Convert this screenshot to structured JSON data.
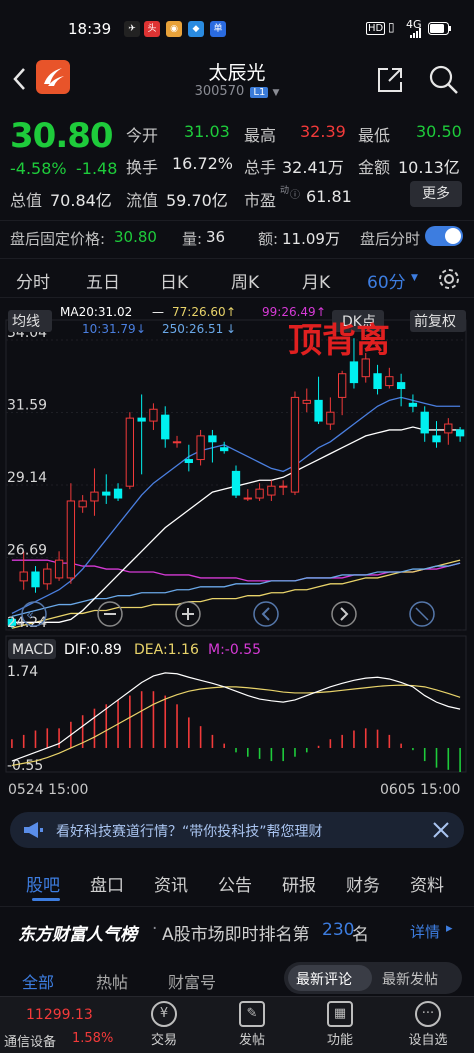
{
  "status_bar": {
    "time": "18:39",
    "signal": "4G",
    "battery": "69"
  },
  "header": {
    "stock_name": "太辰光",
    "stock_code": "300570",
    "market_badge": "L1"
  },
  "quote": {
    "price": "30.80",
    "change_pct": "-4.58%",
    "change": "-1.48",
    "open_label": "今开",
    "open": "31.03",
    "high_label": "最高",
    "high": "32.39",
    "low_label": "最低",
    "low": "30.50",
    "turnover_label": "换手",
    "turnover": "16.72%",
    "volume_label": "总手",
    "volume": "32.41万",
    "amount_label": "金额",
    "amount": "10.13亿",
    "mktcap_label": "总值",
    "mktcap": "70.84亿",
    "float_label": "流值",
    "float_cap": "59.70亿",
    "pe_label": "市盈",
    "pe_sup": "动",
    "pe": "61.81",
    "more_label": "更多"
  },
  "after_hours": {
    "price_label": "盘后固定价格:",
    "price": "30.80",
    "vol_label": "量:",
    "vol": "36",
    "amt_label": "额:",
    "amt": "11.09万",
    "switch_label": "盘后分时"
  },
  "period_tabs": [
    "分时",
    "五日",
    "日K",
    "周K",
    "月K",
    "60分"
  ],
  "active_period": "60分",
  "chart": {
    "ma_button": "均线",
    "ma20": "MA20:31.02",
    "ma77": "77:26.60",
    "ma99": "99:26.49",
    "ma10": "10:31.79",
    "ma250": "250:26.51",
    "dk_label": "DK点",
    "adjust_label": "前复权",
    "annotation": "顶背离",
    "macd_button": "MACD",
    "dif": "DIF:0.89",
    "dea": "DEA:1.16",
    "m": "M:-0.55",
    "date_start": "0524 15:00",
    "date_end": "0605 15:00",
    "colors": {
      "up": "#f23a3a",
      "down": "#00f0f0",
      "ma10": "#4a7fe0",
      "ma20": "#ffffff",
      "ma77": "#e8d36a",
      "ma99": "#d63ad6",
      "ma250": "#6aa8e8"
    }
  },
  "chart_data": {
    "type": "candlestick",
    "y_ticks": [
      34.04,
      31.59,
      29.14,
      26.69,
      24.24
    ],
    "ylim": [
      24.24,
      34.04
    ],
    "candles": [
      {
        "o": 24.6,
        "c": 24.4,
        "h": 24.7,
        "l": 24.3
      },
      {
        "o": 25.9,
        "c": 26.2,
        "h": 26.9,
        "l": 25.6
      },
      {
        "o": 26.2,
        "c": 25.7,
        "h": 26.4,
        "l": 25.5
      },
      {
        "o": 25.8,
        "c": 26.3,
        "h": 26.5,
        "l": 25.6
      },
      {
        "o": 26.0,
        "c": 26.6,
        "h": 26.9,
        "l": 25.9
      },
      {
        "o": 26.0,
        "c": 28.6,
        "h": 29.2,
        "l": 25.8
      },
      {
        "o": 28.4,
        "c": 28.6,
        "h": 28.8,
        "l": 28.2
      },
      {
        "o": 28.6,
        "c": 28.9,
        "h": 29.7,
        "l": 28.1
      },
      {
        "o": 28.9,
        "c": 28.8,
        "h": 29.5,
        "l": 28.5
      },
      {
        "o": 29.0,
        "c": 28.7,
        "h": 29.2,
        "l": 28.6
      },
      {
        "o": 29.1,
        "c": 31.4,
        "h": 31.6,
        "l": 29.0
      },
      {
        "o": 31.4,
        "c": 31.3,
        "h": 32.2,
        "l": 29.5
      },
      {
        "o": 31.3,
        "c": 31.7,
        "h": 31.9,
        "l": 31.0
      },
      {
        "o": 31.5,
        "c": 30.7,
        "h": 31.8,
        "l": 30.4
      },
      {
        "o": 30.6,
        "c": 30.6,
        "h": 30.8,
        "l": 30.4
      },
      {
        "o": 30.0,
        "c": 29.9,
        "h": 30.5,
        "l": 29.6
      },
      {
        "o": 30.0,
        "c": 30.8,
        "h": 31.0,
        "l": 29.8
      },
      {
        "o": 30.8,
        "c": 30.6,
        "h": 31.0,
        "l": 29.9
      },
      {
        "o": 30.4,
        "c": 30.3,
        "h": 30.6,
        "l": 30.2
      },
      {
        "o": 29.6,
        "c": 28.8,
        "h": 29.8,
        "l": 28.7
      },
      {
        "o": 28.7,
        "c": 28.7,
        "h": 29.0,
        "l": 28.6
      },
      {
        "o": 28.7,
        "c": 29.0,
        "h": 29.2,
        "l": 28.6
      },
      {
        "o": 28.8,
        "c": 29.1,
        "h": 29.3,
        "l": 28.6
      },
      {
        "o": 29.1,
        "c": 29.1,
        "h": 29.3,
        "l": 28.8
      },
      {
        "o": 28.9,
        "c": 32.1,
        "h": 32.3,
        "l": 28.8
      },
      {
        "o": 31.9,
        "c": 32.0,
        "h": 32.4,
        "l": 31.6
      },
      {
        "o": 32.0,
        "c": 31.3,
        "h": 32.8,
        "l": 31.2
      },
      {
        "o": 31.2,
        "c": 31.6,
        "h": 32.1,
        "l": 31.0
      },
      {
        "o": 32.1,
        "c": 32.9,
        "h": 33.0,
        "l": 31.5
      },
      {
        "o": 33.3,
        "c": 32.6,
        "h": 34.1,
        "l": 32.4
      },
      {
        "o": 32.8,
        "c": 33.4,
        "h": 33.6,
        "l": 32.6
      },
      {
        "o": 32.9,
        "c": 32.4,
        "h": 33.2,
        "l": 32.2
      },
      {
        "o": 32.5,
        "c": 32.8,
        "h": 33.1,
        "l": 32.4
      },
      {
        "o": 32.6,
        "c": 32.4,
        "h": 32.9,
        "l": 31.8
      },
      {
        "o": 31.9,
        "c": 31.8,
        "h": 32.2,
        "l": 31.6
      },
      {
        "o": 31.6,
        "c": 30.9,
        "h": 31.8,
        "l": 30.6
      },
      {
        "o": 30.8,
        "c": 30.6,
        "h": 31.3,
        "l": 30.4
      },
      {
        "o": 30.9,
        "c": 31.2,
        "h": 31.4,
        "l": 30.5
      },
      {
        "o": 31.0,
        "c": 30.8,
        "h": 31.1,
        "l": 30.6
      }
    ],
    "ma10": [
      24.8,
      25.0,
      25.2,
      25.4,
      25.6,
      25.9,
      26.3,
      26.8,
      27.3,
      27.8,
      28.3,
      28.8,
      29.2,
      29.5,
      29.8,
      30.1,
      30.3,
      30.4,
      30.5,
      30.3,
      30.1,
      29.9,
      29.7,
      29.6,
      29.8,
      30.1,
      30.4,
      30.6,
      30.9,
      31.2,
      31.5,
      31.8,
      32.0,
      32.1,
      32.0,
      31.9,
      31.8,
      31.8,
      31.8
    ],
    "ma20": [
      24.5,
      24.5,
      24.5,
      24.5,
      24.5,
      24.6,
      24.9,
      25.3,
      25.7,
      26.1,
      26.5,
      26.9,
      27.3,
      27.7,
      28.0,
      28.3,
      28.6,
      28.9,
      29.0,
      29.1,
      29.2,
      29.3,
      29.3,
      29.4,
      29.6,
      29.8,
      30.0,
      30.2,
      30.4,
      30.6,
      30.8,
      30.9,
      31.0,
      31.0,
      31.1,
      31.0,
      31.0,
      31.0,
      31.0
    ],
    "ma77": [
      24.3,
      24.4,
      24.5,
      24.6,
      24.7,
      24.8,
      24.8,
      24.9,
      24.9,
      25.0,
      25.0,
      25.0,
      25.1,
      25.1,
      25.1,
      25.2,
      25.2,
      25.3,
      25.3,
      25.3,
      25.4,
      25.4,
      25.5,
      25.5,
      25.6,
      25.6,
      25.7,
      25.8,
      25.8,
      25.9,
      26.0,
      26.0,
      26.1,
      26.2,
      26.2,
      26.3,
      26.4,
      26.5,
      26.6
    ],
    "ma99": [
      26.6,
      26.6,
      26.6,
      26.6,
      26.5,
      26.5,
      26.4,
      26.4,
      26.3,
      26.3,
      26.2,
      26.2,
      26.2,
      26.1,
      26.1,
      26.1,
      26.0,
      26.0,
      26.0,
      26.0,
      25.9,
      25.9,
      25.9,
      25.9,
      25.9,
      26.0,
      26.0,
      26.0,
      26.0,
      26.1,
      26.1,
      26.1,
      26.2,
      26.2,
      26.2,
      26.3,
      26.3,
      26.4,
      26.5
    ],
    "ma250": [
      24.7,
      24.8,
      24.9,
      25.0,
      25.1,
      25.1,
      25.2,
      25.3,
      25.3,
      25.4,
      25.4,
      25.5,
      25.5,
      25.5,
      25.6,
      25.6,
      25.7,
      25.7,
      25.7,
      25.8,
      25.8,
      25.8,
      25.9,
      25.9,
      25.9,
      26.0,
      26.0,
      26.0,
      26.1,
      26.1,
      26.1,
      26.2,
      26.2,
      26.2,
      26.3,
      26.3,
      26.4,
      26.4,
      26.5
    ],
    "macd": {
      "y_ticks": [
        1.74,
        -0.55
      ],
      "ylim": [
        -0.55,
        1.74
      ],
      "dif": [
        -0.3,
        -0.2,
        -0.1,
        0.0,
        0.1,
        0.3,
        0.5,
        0.7,
        0.9,
        1.1,
        1.3,
        1.5,
        1.65,
        1.72,
        1.7,
        1.62,
        1.55,
        1.48,
        1.4,
        1.3,
        1.2,
        1.12,
        1.08,
        1.05,
        1.1,
        1.2,
        1.3,
        1.4,
        1.48,
        1.55,
        1.6,
        1.62,
        1.58,
        1.5,
        1.4,
        1.2,
        1.05,
        0.95,
        0.89
      ],
      "dea": [
        -0.4,
        -0.35,
        -0.3,
        -0.22,
        -0.12,
        0.0,
        0.12,
        0.25,
        0.4,
        0.55,
        0.7,
        0.85,
        1.0,
        1.12,
        1.22,
        1.3,
        1.35,
        1.38,
        1.4,
        1.4,
        1.38,
        1.35,
        1.32,
        1.28,
        1.26,
        1.26,
        1.27,
        1.29,
        1.32,
        1.35,
        1.38,
        1.41,
        1.43,
        1.44,
        1.43,
        1.4,
        1.33,
        1.25,
        1.16
      ],
      "m": [
        0.2,
        0.3,
        0.4,
        0.45,
        0.45,
        0.6,
        0.75,
        0.9,
        1.0,
        1.1,
        1.2,
        1.3,
        1.3,
        1.2,
        1.0,
        0.7,
        0.5,
        0.3,
        0.1,
        -0.1,
        -0.2,
        -0.25,
        -0.3,
        -0.3,
        -0.2,
        -0.1,
        0.05,
        0.2,
        0.3,
        0.4,
        0.45,
        0.42,
        0.3,
        0.1,
        -0.05,
        -0.3,
        -0.45,
        -0.5,
        -0.55
      ]
    }
  },
  "banner": {
    "text": "看好科技赛道行情？“带你投科技”帮您理财"
  },
  "content_tabs": [
    "股吧",
    "盘口",
    "资讯",
    "公告",
    "研报",
    "财务",
    "资料"
  ],
  "rank": {
    "brand": "东方财富人气榜",
    "text_prefix": "A股市场即时排名第",
    "rank_no": "230",
    "text_suffix": "名",
    "detail": "详情"
  },
  "sub_tabs": [
    "全部",
    "热帖",
    "财富号"
  ],
  "sort_options": [
    "最新评论",
    "最新发帖"
  ],
  "bottom_nav": {
    "index_value": "11299.13",
    "index_name": "通信设备",
    "index_pct": "1.58%",
    "items": [
      "交易",
      "发帖",
      "功能",
      "设自选"
    ]
  }
}
